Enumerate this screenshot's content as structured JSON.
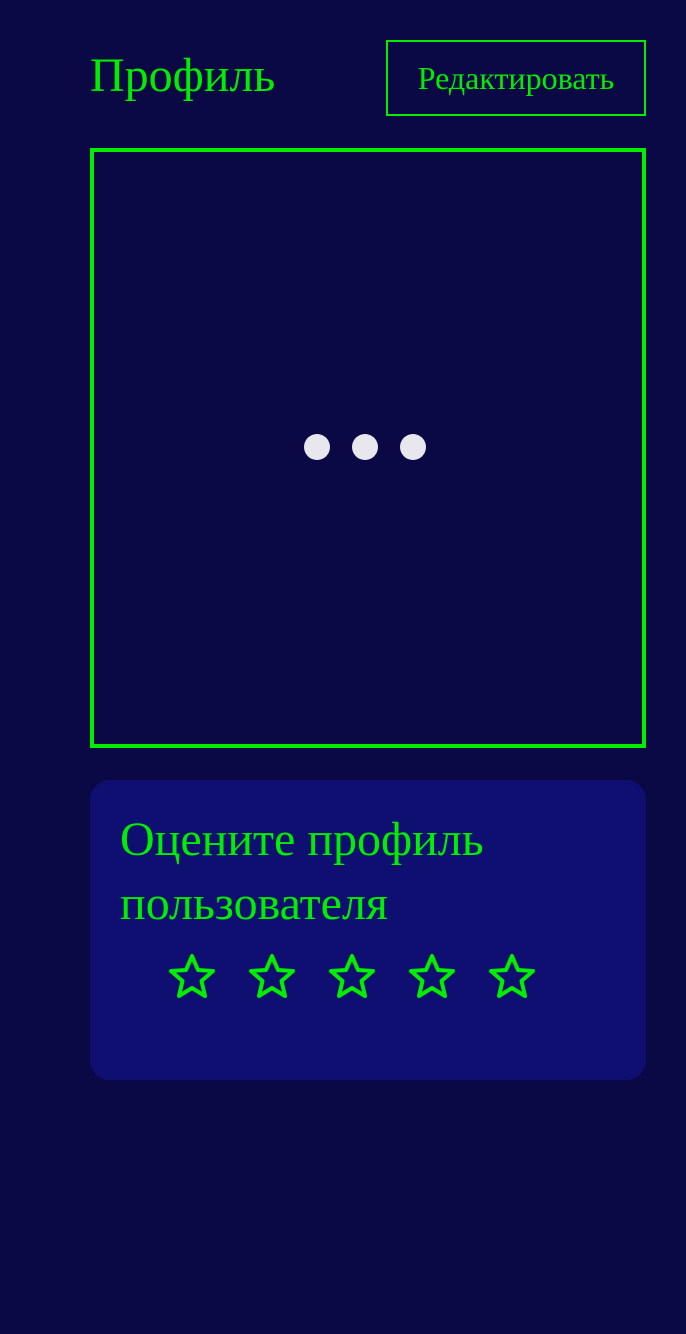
{
  "header": {
    "title": "Профиль",
    "edit_label": "Редактировать"
  },
  "profile_view": {
    "status": "loading",
    "loader_icon": "more-dots-icon"
  },
  "rating": {
    "prompt": "Оцените профиль пользователя",
    "max_stars": 5,
    "selected_stars": 0,
    "star_icon": "star-outline-icon"
  },
  "colors": {
    "background": "#0a0946",
    "card_background": "#0f0f72",
    "accent": "#00ee00",
    "loader_dot": "#e9e7ee"
  }
}
